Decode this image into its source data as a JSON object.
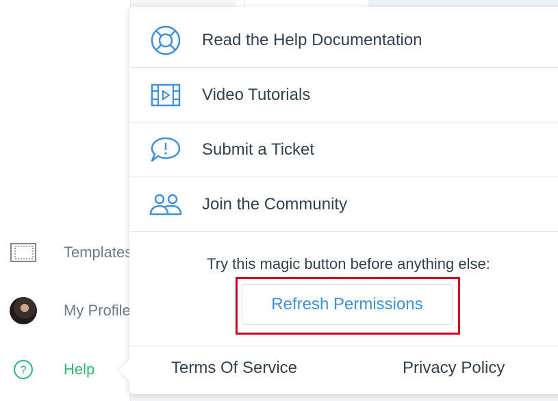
{
  "sidebar": {
    "items": [
      {
        "label": "Templates",
        "icon": "template-icon"
      },
      {
        "label": "My Profile",
        "icon": "avatar"
      },
      {
        "label": "Help",
        "icon": "question-circle-icon"
      }
    ]
  },
  "help_menu": {
    "items": [
      {
        "label": "Read the Help Documentation",
        "icon": "lifebuoy-icon"
      },
      {
        "label": "Video Tutorials",
        "icon": "film-icon"
      },
      {
        "label": "Submit a Ticket",
        "icon": "chat-alert-icon"
      },
      {
        "label": "Join the Community",
        "icon": "users-icon"
      }
    ],
    "magic_prompt": "Try this magic button before anything else:",
    "refresh_button": "Refresh Permissions",
    "footer": {
      "terms": "Terms Of Service",
      "privacy": "Privacy Policy"
    }
  },
  "colors": {
    "icon_blue": "#3d8fe0",
    "help_green": "#2bb673",
    "highlight_red": "#d0021b",
    "text_dark": "#33414e",
    "sidebar_text": "#6b7a86"
  }
}
